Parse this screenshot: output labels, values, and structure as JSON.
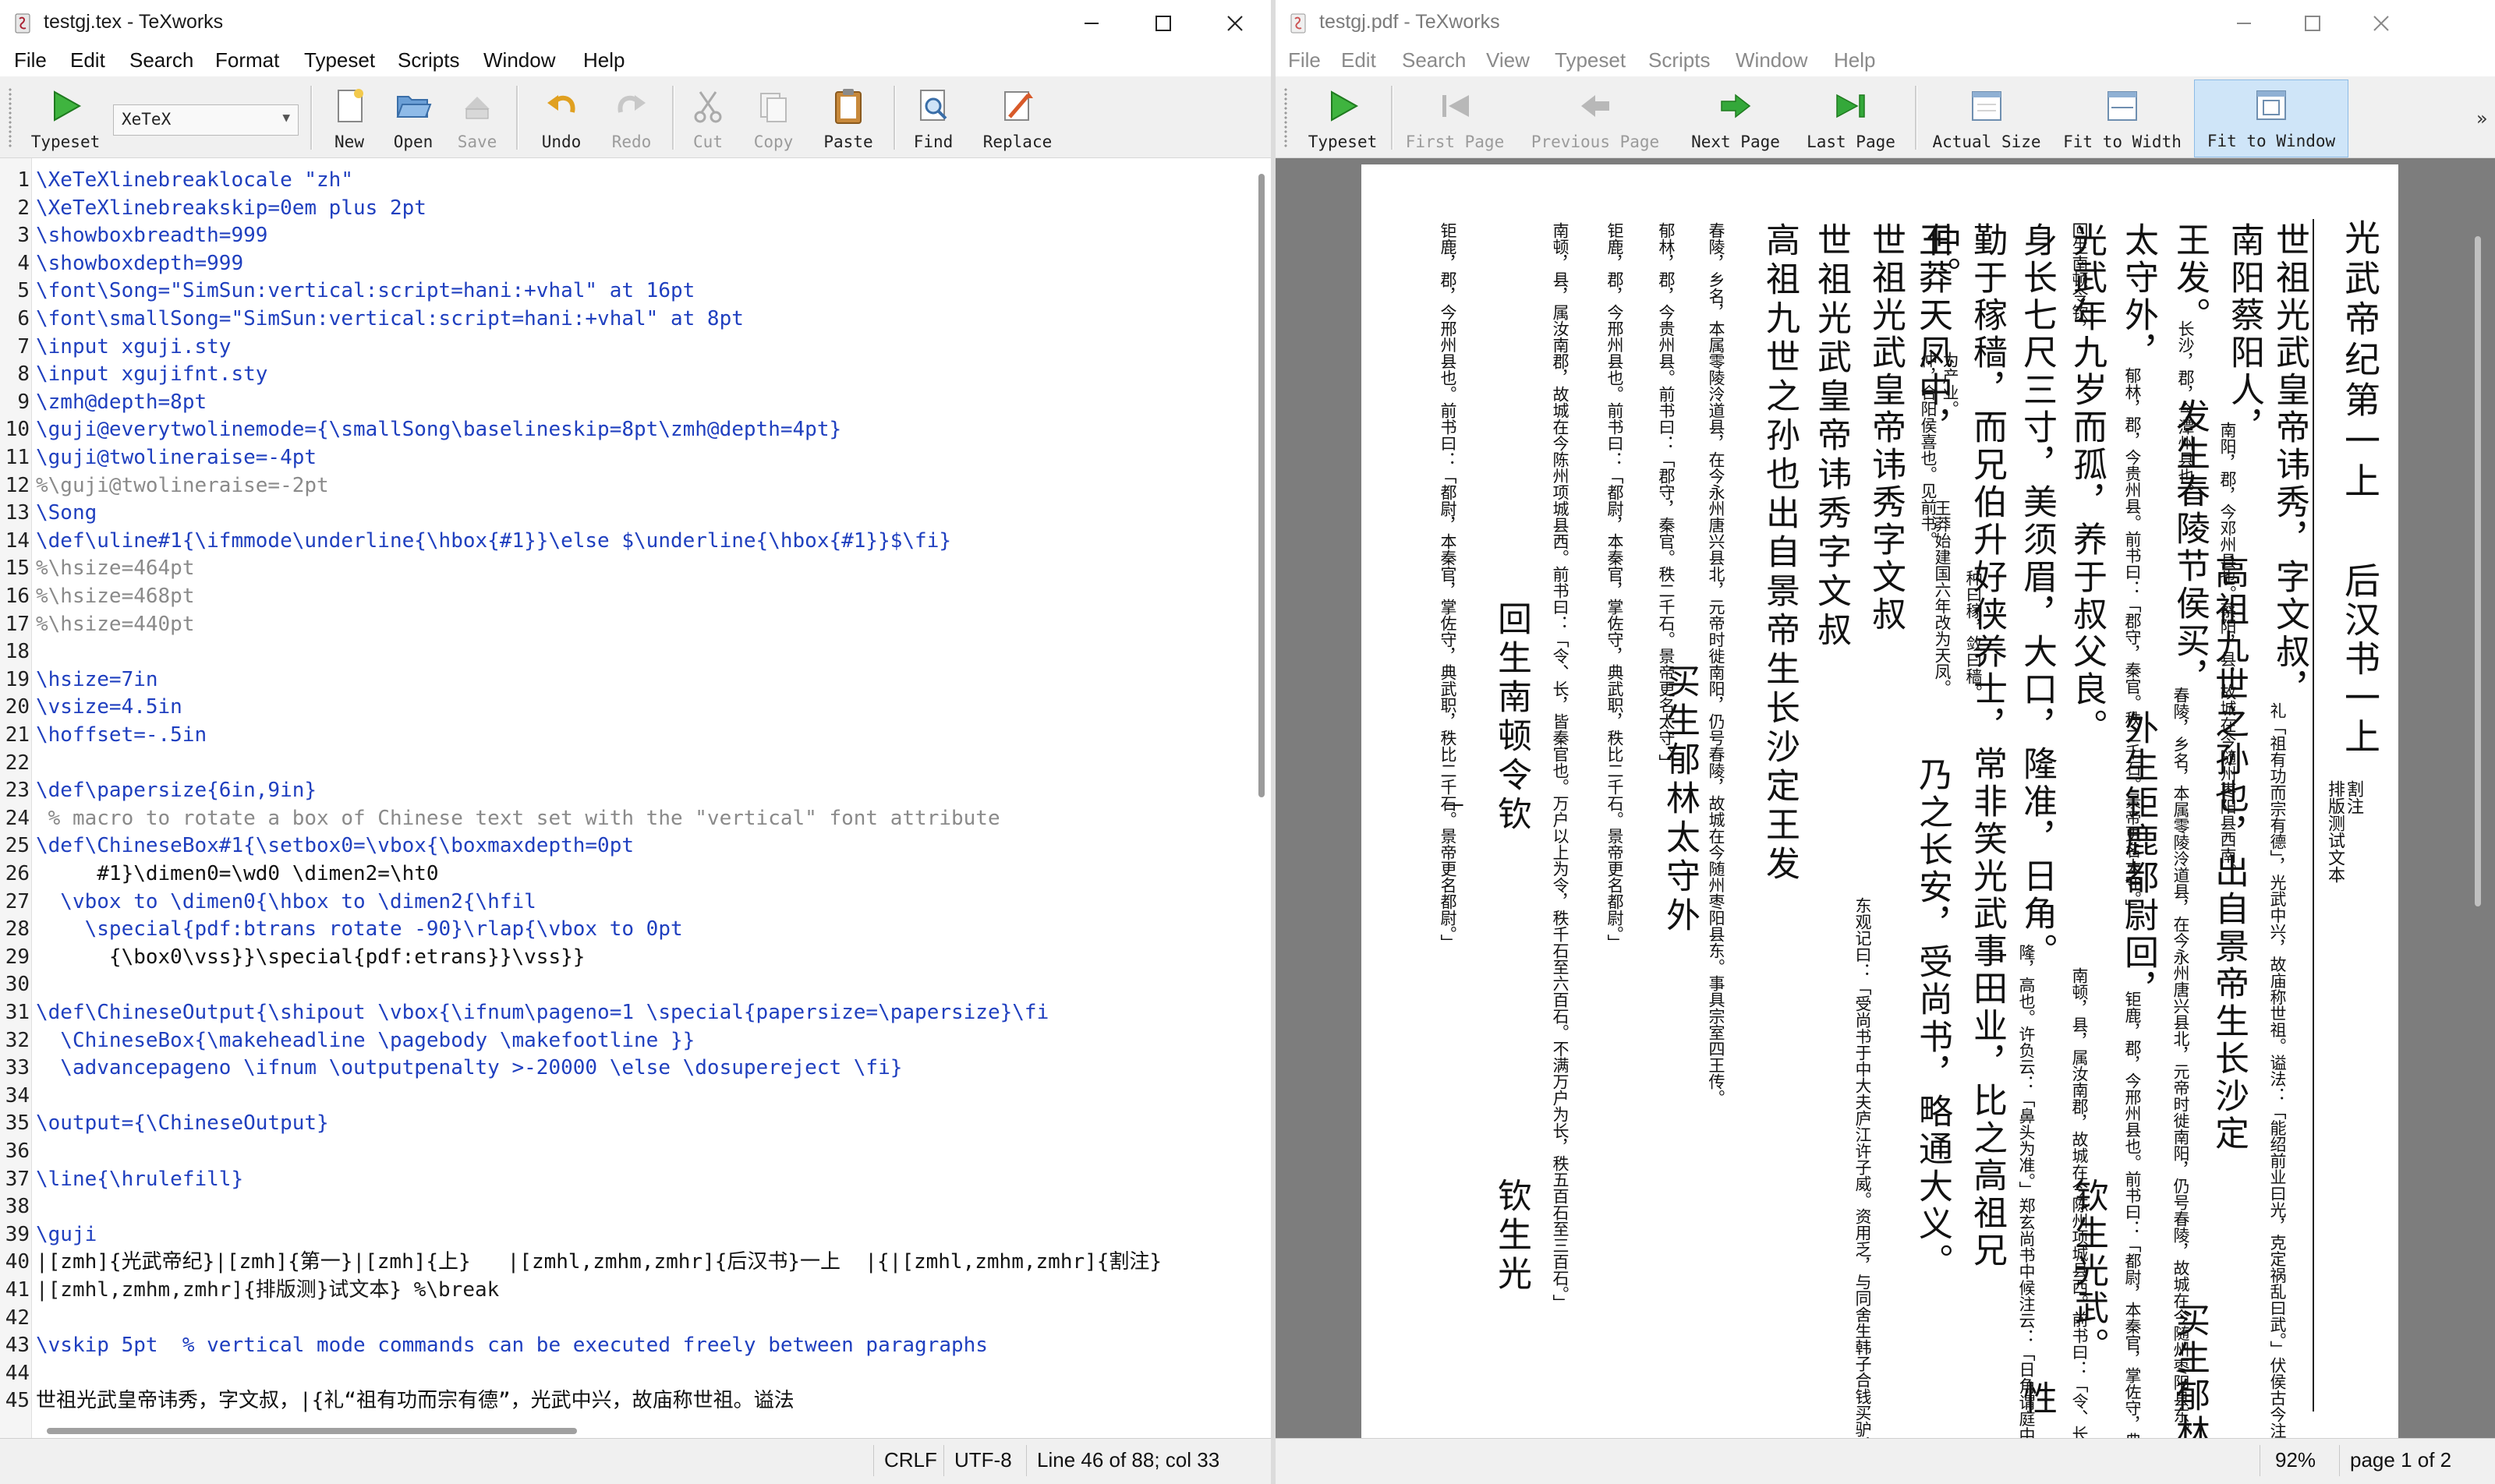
{
  "editor": {
    "window_title": "testgj.tex - TeXworks",
    "menu": [
      "File",
      "Edit",
      "Search",
      "Format",
      "Typeset",
      "Scripts",
      "Window",
      "Help"
    ],
    "toolbar": {
      "typeset": "Typeset",
      "engine": "XeTeX",
      "new": "New",
      "open": "Open",
      "save": "Save",
      "undo": "Undo",
      "redo": "Redo",
      "cut": "Cut",
      "copy": "Copy",
      "paste": "Paste",
      "find": "Find",
      "replace": "Replace"
    },
    "lines": [
      {
        "n": "1",
        "text": "\\XeTeXlinebreaklocale \"zh\""
      },
      {
        "n": "2",
        "text": "\\XeTeXlinebreakskip=0em plus 2pt"
      },
      {
        "n": "3",
        "text": "\\showboxbreadth=999"
      },
      {
        "n": "4",
        "text": "\\showboxdepth=999"
      },
      {
        "n": "5",
        "text": "\\font\\Song=\"SimSun:vertical:script=hani:+vhal\" at 16pt"
      },
      {
        "n": "6",
        "text": "\\font\\smallSong=\"SimSun:vertical:script=hani:+vhal\" at 8pt"
      },
      {
        "n": "7",
        "text": "\\input xguji.sty"
      },
      {
        "n": "8",
        "text": "\\input xgujifnt.sty"
      },
      {
        "n": "9",
        "text": "\\zmh@depth=8pt"
      },
      {
        "n": "10",
        "text": "\\guji@everytwolinemode={\\smallSong\\baselineskip=8pt\\zmh@depth=4pt}"
      },
      {
        "n": "11",
        "text": "\\guji@twolineraise=-4pt"
      },
      {
        "n": "12",
        "text": "%\\guji@twolineraise=-2pt"
      },
      {
        "n": "13",
        "text": "\\Song"
      },
      {
        "n": "14",
        "text": "\\def\\uline#1{\\ifmmode\\underline{\\hbox{#1}}\\else $\\underline{\\hbox{#1}}$\\fi}"
      },
      {
        "n": "15",
        "text": "%\\hsize=464pt"
      },
      {
        "n": "16",
        "text": "%\\hsize=468pt"
      },
      {
        "n": "17",
        "text": "%\\hsize=440pt"
      },
      {
        "n": "18",
        "text": ""
      },
      {
        "n": "19",
        "text": "\\hsize=7in"
      },
      {
        "n": "20",
        "text": "\\vsize=4.5in"
      },
      {
        "n": "21",
        "text": "\\hoffset=-.5in"
      },
      {
        "n": "22",
        "text": ""
      },
      {
        "n": "23",
        "text": "\\def\\papersize{6in,9in}"
      },
      {
        "n": "24",
        "text": " % macro to rotate a box of Chinese text set with the \"vertical\" font attribute"
      },
      {
        "n": "25",
        "text": "\\def\\ChineseBox#1{\\setbox0=\\vbox{\\boxmaxdepth=0pt"
      },
      {
        "n": "26",
        "text": "     #1}\\dimen0=\\wd0 \\dimen2=\\ht0"
      },
      {
        "n": "27",
        "text": "  \\vbox to \\dimen0{\\hbox to \\dimen2{\\hfil"
      },
      {
        "n": "28",
        "text": "    \\special{pdf:btrans rotate -90}\\rlap{\\vbox to 0pt"
      },
      {
        "n": "29",
        "text": "      {\\box0\\vss}}\\special{pdf:etrans}}\\vss}}"
      },
      {
        "n": "30",
        "text": ""
      },
      {
        "n": "31",
        "text": "\\def\\ChineseOutput{\\shipout \\vbox{\\ifnum\\pageno=1 \\special{papersize=\\papersize}\\fi"
      },
      {
        "n": "32",
        "text": "  \\ChineseBox{\\makeheadline \\pagebody \\makefootline }}"
      },
      {
        "n": "33",
        "text": "  \\advancepageno \\ifnum \\outputpenalty >-20000 \\else \\dosupereject \\fi}"
      },
      {
        "n": "34",
        "text": ""
      },
      {
        "n": "35",
        "text": "\\output={\\ChineseOutput}"
      },
      {
        "n": "36",
        "text": ""
      },
      {
        "n": "37",
        "text": "\\line{\\hrulefill}"
      },
      {
        "n": "38",
        "text": ""
      },
      {
        "n": "39",
        "text": "\\guji"
      },
      {
        "n": "40",
        "text": "|[zmh]{光武帝纪}|[zmh]{第一}|[zmh]{上}   |[zmhl,zmhm,zmhr]{后汉书}一上  |{|[zmhl,zmhm,zmhr]{割注}"
      },
      {
        "n": "41",
        "text": "|[zmhl,zmhm,zmhr]{排版测}试文本} %\\break"
      },
      {
        "n": "42",
        "text": ""
      },
      {
        "n": "43",
        "text": "\\vskip 5pt  % vertical mode commands can be executed freely between paragraphs"
      },
      {
        "n": "44",
        "text": ""
      },
      {
        "n": "45",
        "text": "世祖光武皇帝讳秀，字文叔，|{礼“祖有功而宗有德”，光武中兴，故庙称世祖。谥法"
      }
    ],
    "status": {
      "line_ending": "CRLF",
      "encoding": "UTF-8",
      "position": "Line 46 of 88; col 33"
    }
  },
  "viewer": {
    "window_title": "testgj.pdf - TeXworks",
    "menu": [
      "File",
      "Edit",
      "Search",
      "View",
      "Typeset",
      "Scripts",
      "Window",
      "Help"
    ],
    "toolbar": {
      "typeset": "Typeset",
      "first_page": "First Page",
      "previous_page": "Previous Page",
      "next_page": "Next Page",
      "last_page": "Last Page",
      "actual_size": "Actual Size",
      "fit_to_width": "Fit to Width",
      "fit_to_window": "Fit to Window",
      "overflow": "»"
    },
    "pdf": {
      "title_main": "光武帝纪第一上",
      "title_sub": "后汉书一上",
      "title_note_right": "割注",
      "title_note_left": "排版测试文本",
      "page_marker": "一",
      "main_columns": [
        "世祖光武皇帝讳秀，字文叔，",
        "南阳蔡阳人，",
        "王发。",
        "太守外，",
        "光武年九岁而孤，养于叔父良。",
        "身长七尺三寸，美须眉，大口，隆准，日角。",
        "勤于稼穑，而兄伯升好侠养士，常非笑光武事田业，比之高祖兄",
        "仲。",
        "世祖光武皇帝讳秀字文叔",
        "高祖九世之孙也出自景帝生长沙定王发",
        "买生郁林太守外",
        "回生南顿令钦",
        "钦生光"
      ],
      "notes": [
        "礼「祖有功而宗有德」，光武中兴，故庙称世祖。谥法：「能绍前业曰光，克定祸乱曰武。」伏侯古今注曰：「秀之字曰茂，伯、仲、叔、季，兄弟之次。长兄伯升，次仲，故字文叔焉。」",
        "南阳，郡，今邓州县也。蔡阳，县，故城在今随州枣阳县西南。",
        "高祖九世之孙也，出自景帝生长沙定",
        "长沙，郡，今潭州县也。",
        "发生春陵节侯买，",
        "春陵，乡名，本属零陵泠道县，在今永州唐兴县北，元帝时徙南阳，仍号春陵，故城在今随州枣阳县东。事具宗室四王传。",
        "买生郁林",
        "郁林，郡，今贵州县。前书曰：「郡守，秦官。秩二千石。景帝更名太守。」",
        "外生钜鹿都尉回，",
        "钜鹿，郡，今邢州县也。前书曰：「都尉，本秦官，掌佐守，典武职，秩比二千石。景帝更名都尉。」",
        "回生南顿令钦，",
        "南顿，县，属汝南郡，故城在今陈州项城县西。前书曰：「令、长，皆秦官也。万户以上为令，秩千石至六百石。不满万户为长，秩五百石至三百石。」",
        "钦生光武。",
        "隆，高也。许负云：「鼻头为准。」郑玄尚书中候注云：「日角谓庭中骨起，状如日。」",
        "性",
        "王莽天凤中，",
        "天凤，王莽年号。",
        "乃之长安，受尚书，略通大义。",
        "东观记曰：「受尚书于中大夫庐江许子威。资用乏，与同舍生韩子合钱买驴，令从者僦，以给诸公费。」",
        "王莽始建国六年改为天凤。",
        "种曰稼，敛曰穑。",
        "仲，合阳侯喜也。见前书。",
        "为产业。"
      ]
    },
    "status": {
      "zoom": "92%",
      "page": "page 1 of 2"
    }
  }
}
